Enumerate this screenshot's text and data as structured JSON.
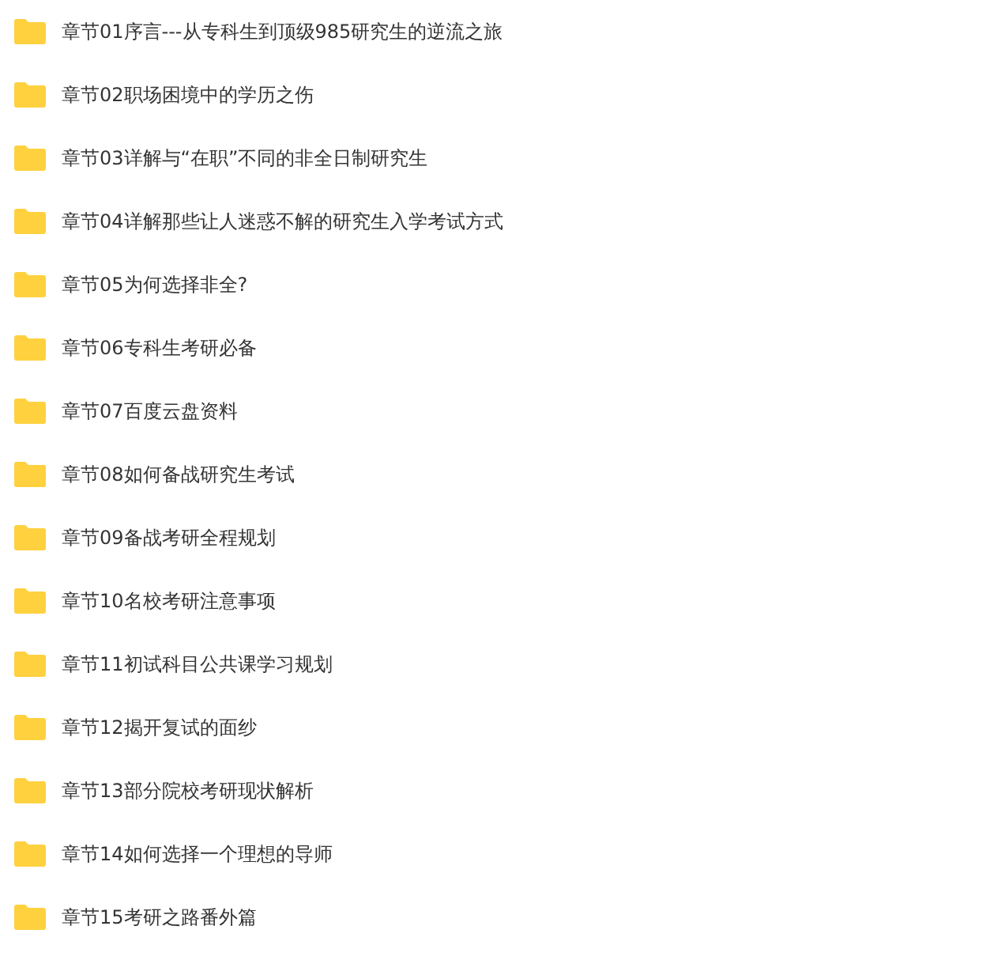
{
  "folders": [
    {
      "name": "章节01序言---从专科生到顶级985研究生的逆流之旅"
    },
    {
      "name": "章节02职场困境中的学历之伤"
    },
    {
      "name": "章节03详解与“在职”不同的非全日制研究生"
    },
    {
      "name": "章节04详解那些让人迷惑不解的研究生入学考试方式"
    },
    {
      "name": "章节05为何选择非全?"
    },
    {
      "name": "章节06专科生考研必备"
    },
    {
      "name": "章节07百度云盘资料"
    },
    {
      "name": "章节08如何备战研究生考试"
    },
    {
      "name": "章节09备战考研全程规划"
    },
    {
      "name": "章节10名校考研注意事项"
    },
    {
      "name": "章节11初试科目公共课学习规划"
    },
    {
      "name": "章节12揭开复试的面纱"
    },
    {
      "name": "章节13部分院校考研现状解析"
    },
    {
      "name": "章节14如何选择一个理想的导师"
    },
    {
      "name": "章节15考研之路番外篇"
    }
  ]
}
